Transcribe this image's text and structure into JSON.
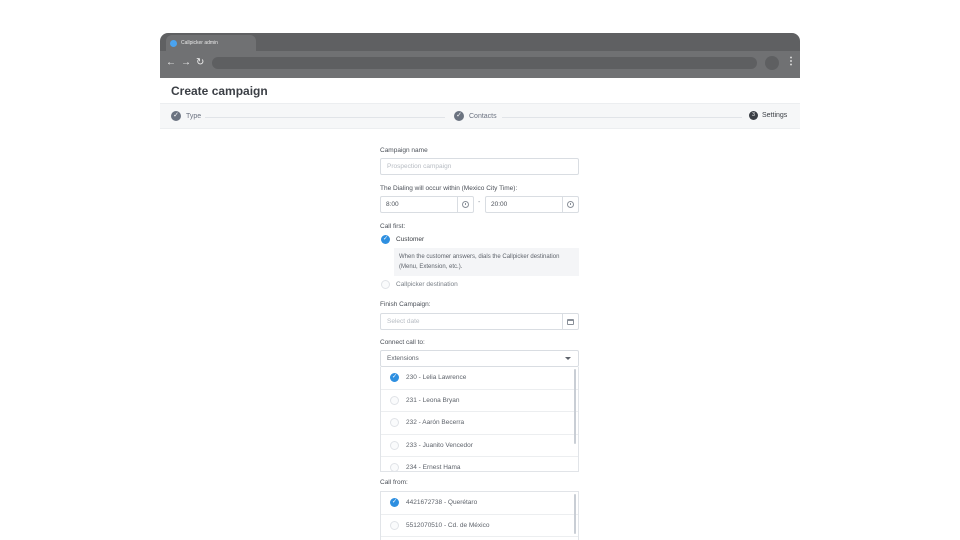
{
  "browser": {
    "tab_title": "Callpicker admin",
    "back_icon": "arrow-left-icon",
    "forward_icon": "arrow-right-icon",
    "reload_icon": "reload-icon",
    "menu_icon": "vertical-dots-icon"
  },
  "page": {
    "title": "Create campaign"
  },
  "stepper": {
    "steps": [
      {
        "label": "Type",
        "state": "done"
      },
      {
        "label": "Contacts",
        "state": "done"
      },
      {
        "label": "Settings",
        "state": "current",
        "number": "3"
      }
    ]
  },
  "form": {
    "campaign_name": {
      "label": "Campaign name",
      "placeholder": "Prospection campaign"
    },
    "dialing_window": {
      "label": "The Dialing will occur within (Mexico City Time):",
      "start": "8:00",
      "separator": "-",
      "end": "20:00"
    },
    "call_first": {
      "label": "Call first:",
      "options": [
        {
          "label": "Customer",
          "selected": true
        },
        {
          "label": "Callpicker destination",
          "selected": false
        }
      ],
      "hint": "When the customer answers, dials the Callpicker destination (Menu, Extension, etc.)."
    },
    "finish_campaign": {
      "label": "Finish Campaign:",
      "placeholder": "Select date"
    },
    "connect_call_to": {
      "label": "Connect call to:",
      "selected": "Extensions",
      "items": [
        {
          "label": "230 - Lelia Lawrence",
          "checked": true
        },
        {
          "label": "231 - Leona Bryan",
          "checked": false
        },
        {
          "label": "232 - Aarón Becerra",
          "checked": false
        },
        {
          "label": "233 - Juanito Vencedor",
          "checked": false
        },
        {
          "label": "234 - Ernest Hama",
          "checked": false
        }
      ]
    },
    "call_from": {
      "label": "Call from:",
      "items": [
        {
          "label": "4421672738 - Querétaro",
          "checked": true
        },
        {
          "label": "5512070510 - Cd. de México",
          "checked": false
        }
      ]
    }
  },
  "colors": {
    "accent": "#2e8fe0",
    "browser_chrome": "#5f6062",
    "text_dark": "#3b3f45"
  }
}
